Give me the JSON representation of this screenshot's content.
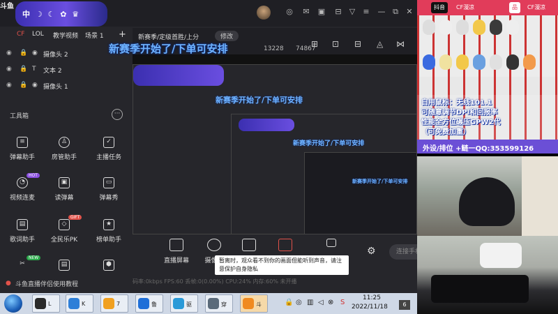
{
  "app": {
    "brand": "斗鱼",
    "banner_text": "中 ☽ ☾ ✿ ♛",
    "scene_tabs": [
      "CF",
      "LOL",
      "教学视频",
      "场景 1"
    ],
    "sources": [
      {
        "name": "摄像头 2",
        "type": "◉"
      },
      {
        "name": "文本 2",
        "type": "T"
      },
      {
        "name": "摄像头 1",
        "type": "◉"
      }
    ],
    "tools_label": "工具箱",
    "tools_more": "···",
    "tools": [
      {
        "label": "弹幕助手",
        "icon": "≡",
        "tag": ""
      },
      {
        "label": "房管助手",
        "icon": "♙",
        "tag": ""
      },
      {
        "label": "主播任务",
        "icon": "✓",
        "tag": ""
      },
      {
        "label": "视频连麦",
        "icon": "◔",
        "tag": "HOT"
      },
      {
        "label": "读弹幕",
        "icon": "▣",
        "tag": ""
      },
      {
        "label": "弹幕秀",
        "icon": "▭",
        "tag": ""
      },
      {
        "label": "歌词助手",
        "icon": "▤",
        "tag": ""
      },
      {
        "label": "全民乐PK",
        "icon": "◇",
        "tag": "GIFT"
      },
      {
        "label": "榜单助手",
        "icon": "★",
        "tag": ""
      }
    ],
    "help_text": "斗鱼直播伴侣使用教程",
    "room_title": "新赛季/定级首胜/上分",
    "edit_label": "修改",
    "stat_a": "13228",
    "stat_b": "74867",
    "overlay_text": "新赛季开始了/下单可安排",
    "controls": [
      "直播屏幕",
      "摄像头",
      "",
      "",
      ""
    ],
    "start_label": "连接手机",
    "tooltip": "暂离时，观众看不到你的画面但能听到声音，请注意保护自身隐私",
    "status_strip": "码率:0kbps    FPS:60    丢帧:0(0.00%)    CPU:24%    内存:60%    未开播"
  },
  "taskbar": {
    "items": [
      {
        "label": "L",
        "color": "#2a2a2a"
      },
      {
        "label": "K",
        "color": "#2e7fd8"
      },
      {
        "label": "7",
        "color": "#f0a020"
      },
      {
        "label": "鲁",
        "color": "#1f6fd8"
      },
      {
        "label": "驱",
        "color": "#2a9ad8"
      },
      {
        "label": "穿",
        "color": "#5a6a7a"
      },
      {
        "label": "斗",
        "color": "#f08a20"
      }
    ],
    "time": "11:25",
    "date": "2022/11/18",
    "notif": "6"
  },
  "right": {
    "platform_left": "抖音",
    "platform_label": "CF漫凉",
    "platform_label2": "CF漫凉",
    "promo_lines": [
      "自用鼠标：无线101.1",
      "可随意调节DPI和回报率",
      "性能全方位碾压GPW2代",
      "（可免费加重）"
    ],
    "qq_text": "外设/排位   +鲢一QQ:353599126"
  }
}
